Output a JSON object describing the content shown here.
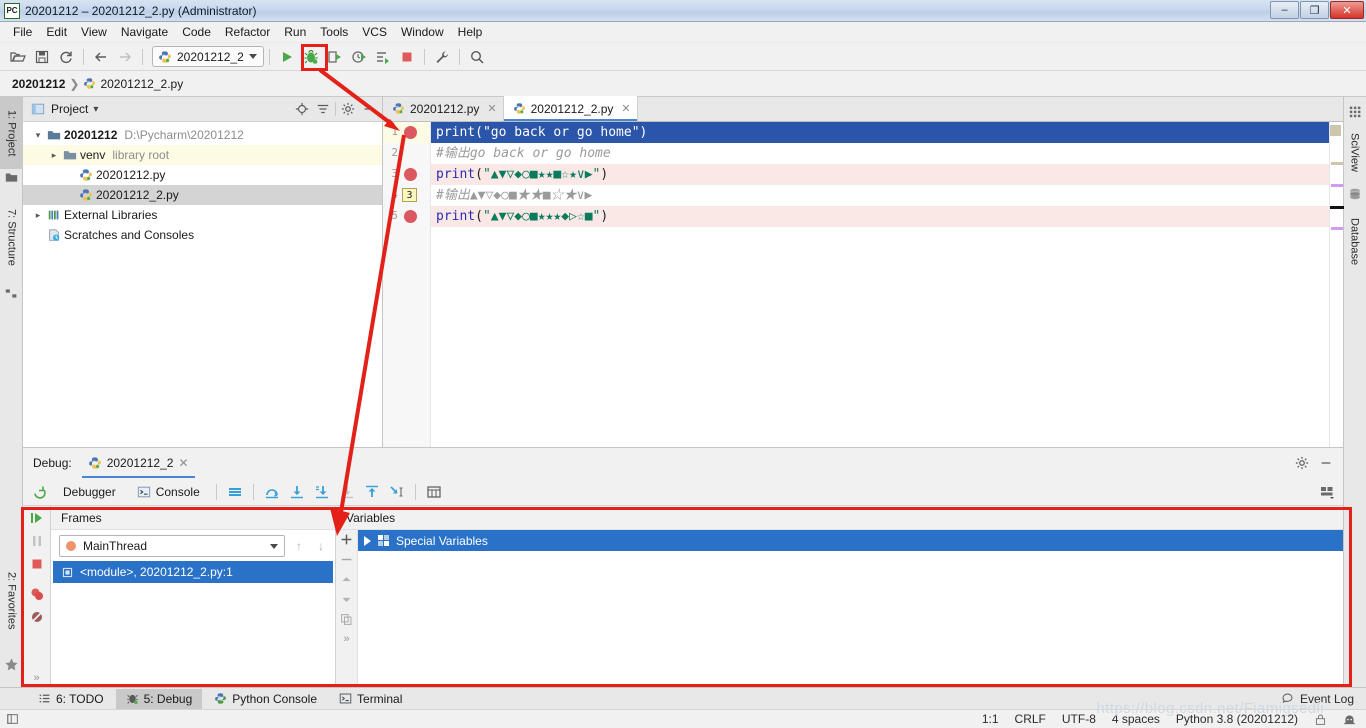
{
  "window": {
    "title": "20201212 – 20201212_2.py (Administrator)",
    "app_icon": "pycharm-icon",
    "minimize_label": "–",
    "restore_label": "❐",
    "close_label": "✕"
  },
  "menubar": {
    "items": [
      {
        "label": "File"
      },
      {
        "label": "Edit"
      },
      {
        "label": "View"
      },
      {
        "label": "Navigate"
      },
      {
        "label": "Code"
      },
      {
        "label": "Refactor"
      },
      {
        "label": "Run"
      },
      {
        "label": "Tools"
      },
      {
        "label": "VCS"
      },
      {
        "label": "Window"
      },
      {
        "label": "Help"
      }
    ]
  },
  "toolbar": {
    "icons": [
      "open-folder-icon",
      "save-icon",
      "sync-icon",
      "back-arrow-icon",
      "forward-arrow-icon"
    ],
    "run_config": "20201212_2",
    "run_config_icon": "python-file-icon",
    "actions": [
      "run-icon",
      "debug-icon",
      "run-coverage-icon",
      "profile-icon",
      "run-with-console-icon",
      "stop-icon",
      "settings-wrench-icon",
      "search-icon"
    ],
    "highlighted_action": "debug-icon"
  },
  "breadcrumb": {
    "project": "20201212",
    "separator": "❯",
    "file": "20201212_2.py"
  },
  "left_strip": {
    "tabs": [
      {
        "label": "1: Project",
        "selected": true,
        "icon": "project-folder-icon"
      },
      {
        "label": "7: Structure",
        "selected": false,
        "icon": "structure-icon"
      },
      {
        "label": "2: Favorites",
        "selected": false,
        "icon": "star-icon"
      }
    ]
  },
  "right_strip": {
    "tabs": [
      {
        "label": "SciView",
        "icon": "grid-icon"
      },
      {
        "label": "Database",
        "icon": "database-icon"
      }
    ]
  },
  "project_panel": {
    "title": "Project",
    "title_icon": "project-window-icon",
    "caret": "▾",
    "header_icons": [
      "locate-icon",
      "collapse-all-icon",
      "gear-icon",
      "hide-icon"
    ],
    "tree": [
      {
        "indent": 0,
        "twisty": "▾",
        "icon": "folder-icon",
        "label": "20201212",
        "bold": true,
        "sub": "D:\\Pycharm\\20201212",
        "selected": false,
        "highlight": false
      },
      {
        "indent": 1,
        "twisty": "▸",
        "icon": "folder-icon",
        "label": "venv",
        "bold": false,
        "sub": "library root",
        "selected": false,
        "highlight": true
      },
      {
        "indent": 2,
        "twisty": "",
        "icon": "python-file-icon",
        "label": "20201212.py",
        "bold": false,
        "sub": "",
        "selected": false,
        "highlight": false
      },
      {
        "indent": 2,
        "twisty": "",
        "icon": "python-file-icon",
        "label": "20201212_2.py",
        "bold": false,
        "sub": "",
        "selected": true,
        "highlight": false
      },
      {
        "indent": 0,
        "twisty": "▸",
        "icon": "libraries-icon",
        "label": "External Libraries",
        "bold": false,
        "sub": "",
        "selected": false,
        "highlight": false
      },
      {
        "indent": 0,
        "twisty": "",
        "icon": "scratches-icon",
        "label": "Scratches and Consoles",
        "bold": false,
        "sub": "",
        "selected": false,
        "highlight": false
      }
    ]
  },
  "editor": {
    "tabs": [
      {
        "label": "20201212.py",
        "icon": "python-file-icon",
        "close": "✕",
        "active": false
      },
      {
        "label": "20201212_2.py",
        "icon": "python-file-icon",
        "close": "✕",
        "active": true
      }
    ],
    "lines": [
      {
        "number": "1",
        "breakpoint": true,
        "marker": "",
        "selected": true,
        "pink": false,
        "comment": false,
        "fn": "print",
        "open": "(",
        "quote_open": "\"",
        "text": "go back or go home",
        "quote_close": "\"",
        "close": ")"
      },
      {
        "number": "2",
        "breakpoint": false,
        "marker": "",
        "selected": false,
        "pink": false,
        "comment": true,
        "raw": "#输出go back or go home"
      },
      {
        "number": "3",
        "breakpoint": true,
        "marker": "",
        "selected": false,
        "pink": true,
        "comment": false,
        "fn": "print",
        "open": "(",
        "quote_open": "\"",
        "text": "▲▼▽◆○■★★■☆★∨▶",
        "quote_close": "\"",
        "close": ")"
      },
      {
        "number": "4",
        "breakpoint": false,
        "marker": "3",
        "selected": false,
        "pink": false,
        "comment": true,
        "raw": "#输出▲▼▽◆○■★★■☆★∨▶"
      },
      {
        "number": "5",
        "breakpoint": true,
        "marker": "",
        "selected": false,
        "pink": true,
        "comment": false,
        "fn": "print",
        "open": "(",
        "quote_open": "\"",
        "text": "▲▼▽◆○■★★★◆▷☆■",
        "quote_close": "\"",
        "close": ")"
      }
    ]
  },
  "debug": {
    "label": "Debug:",
    "run_tab": "20201212_2",
    "run_tab_icon": "python-file-icon",
    "run_tab_close": "✕",
    "header_icons": [
      "gear-icon",
      "minimize-icon"
    ],
    "restore_layout_icon": "layout-icon",
    "rerun_icon": "rerun-icon",
    "tabs": [
      {
        "label": "Debugger",
        "icon": "",
        "active": true
      },
      {
        "label": "Console",
        "icon": "console-icon",
        "active": false
      }
    ],
    "step_icons": [
      "show-hide-frames-icon",
      "step-over-icon",
      "step-into-icon",
      "force-step-into-icon",
      "step-into-my-code-icon",
      "step-out-icon",
      "run-to-cursor-icon",
      "evaluate-expression-icon"
    ],
    "actions": [
      "resume-program-icon",
      "pause-program-icon",
      "stop-icon",
      "view-breakpoints-icon",
      "mute-breakpoints-icon",
      "more-icon"
    ],
    "frames": {
      "header": "Frames",
      "thread": "MainThread",
      "thread_dot_color": "#f0956b",
      "up_arrow": "↑",
      "down_arrow": "↓",
      "stack": [
        {
          "label": "<module>, 20201212_2.py:1",
          "icon": "frame-icon",
          "selected": true
        }
      ]
    },
    "variables": {
      "header": "Variables",
      "side_icons": [
        "add-icon",
        "remove-icon",
        "up-icon",
        "down-icon",
        "copy-icon",
        "more-icon"
      ],
      "rows": [
        {
          "label": "Special Variables",
          "icon": "special-variables-icon",
          "expander": "▶",
          "selected": true
        }
      ]
    }
  },
  "bottom_bar": {
    "items": [
      {
        "label": "6: TODO",
        "icon": "todo-list-icon",
        "selected": false
      },
      {
        "label": "5: Debug",
        "icon": "debug-bug-icon",
        "selected": true
      },
      {
        "label": "Python Console",
        "icon": "python-console-icon",
        "selected": false
      },
      {
        "label": "Terminal",
        "icon": "terminal-icon",
        "selected": false
      }
    ],
    "event_log": "Event Log",
    "event_log_icon": "event-log-icon"
  },
  "status_bar": {
    "left_icon": "show-tool-windows-icon",
    "caret": "1:1",
    "line_separator": "CRLF",
    "encoding": "UTF-8",
    "indent": "4 spaces",
    "interpreter": "Python 3.8 (20201212)",
    "lock_icon": "read-only-lock-icon",
    "inspection_icon": "hector-inspection-icon"
  },
  "watermark": "https://blog.csdn.net/Fiamigsedli",
  "annotation": {
    "box_color": "#e32119",
    "arrow_color": "#e32119"
  }
}
